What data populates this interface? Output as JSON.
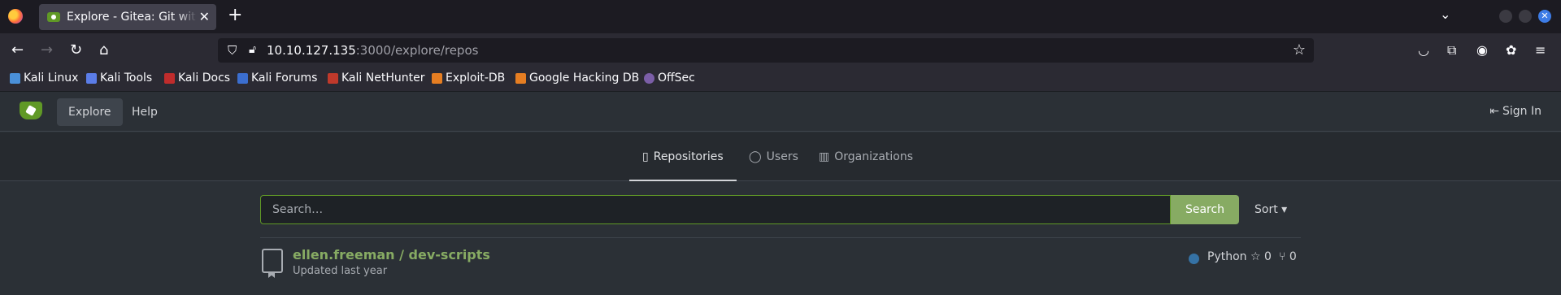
{
  "browser": {
    "tab_title": "Explore - Gitea: Git with a cup of tea",
    "tab_close": "✕",
    "new_tab": "+",
    "url_host": "10.10.127.135",
    "url_rest": ":3000/explore/repos",
    "bookmarks": [
      "Kali Linux",
      "Kali Tools",
      "Kali Docs",
      "Kali Forums",
      "Kali NetHunter",
      "Exploit-DB",
      "Google Hacking DB",
      "OffSec"
    ]
  },
  "header": {
    "explore": "Explore",
    "help": "Help",
    "sign_in": "Sign In"
  },
  "subnav": {
    "repositories": "Repositories",
    "users": "Users",
    "organizations": "Organizations"
  },
  "search": {
    "placeholder": "Search…",
    "button": "Search",
    "sort": "Sort ▾"
  },
  "repo": {
    "name": "ellen.freeman / dev-scripts",
    "updated": "Updated last year",
    "language": "Python",
    "language_color": "#3572a5",
    "stars": "☆ 0",
    "forks": "⑂ 0"
  },
  "colors": {
    "accent": "#609926",
    "link": "#87ab63"
  }
}
